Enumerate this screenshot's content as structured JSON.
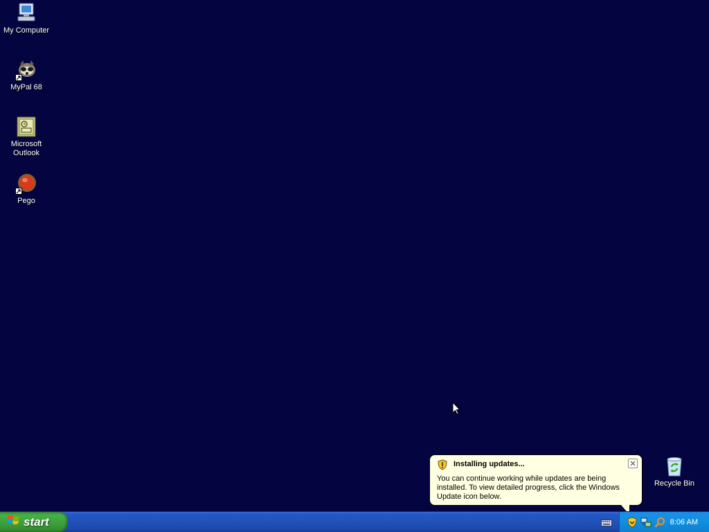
{
  "desktop": {
    "icons": [
      {
        "label": "My Computer",
        "icon": "my-computer-icon"
      },
      {
        "label": "MyPal 68",
        "icon": "mypal-icon"
      },
      {
        "label": "Microsoft\nOutlook",
        "icon": "outlook-icon"
      },
      {
        "label": "Pego",
        "icon": "pego-icon"
      },
      {
        "label": "Recycle Bin",
        "icon": "recycle-bin-icon"
      }
    ],
    "background_color": "#040440"
  },
  "taskbar": {
    "start_label": "start",
    "clock": "8:06 AM",
    "tray_icons": [
      "windows-update-shield-icon",
      "network-icon",
      "search-icon"
    ]
  },
  "balloon": {
    "title": "Installing updates...",
    "body": "You can continue working while updates are being installed. To view detailed progress, click the Windows Update icon below.",
    "background_color": "#ffffe1"
  }
}
